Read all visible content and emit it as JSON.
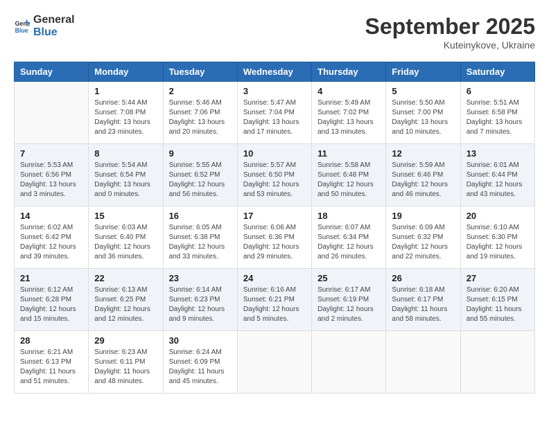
{
  "header": {
    "logo_general": "General",
    "logo_blue": "Blue",
    "month": "September 2025",
    "location": "Kuteinykove, Ukraine"
  },
  "days_of_week": [
    "Sunday",
    "Monday",
    "Tuesday",
    "Wednesday",
    "Thursday",
    "Friday",
    "Saturday"
  ],
  "weeks": [
    [
      {
        "day": "",
        "info": ""
      },
      {
        "day": "1",
        "info": "Sunrise: 5:44 AM\nSunset: 7:08 PM\nDaylight: 13 hours\nand 23 minutes."
      },
      {
        "day": "2",
        "info": "Sunrise: 5:46 AM\nSunset: 7:06 PM\nDaylight: 13 hours\nand 20 minutes."
      },
      {
        "day": "3",
        "info": "Sunrise: 5:47 AM\nSunset: 7:04 PM\nDaylight: 13 hours\nand 17 minutes."
      },
      {
        "day": "4",
        "info": "Sunrise: 5:49 AM\nSunset: 7:02 PM\nDaylight: 13 hours\nand 13 minutes."
      },
      {
        "day": "5",
        "info": "Sunrise: 5:50 AM\nSunset: 7:00 PM\nDaylight: 13 hours\nand 10 minutes."
      },
      {
        "day": "6",
        "info": "Sunrise: 5:51 AM\nSunset: 6:58 PM\nDaylight: 13 hours\nand 7 minutes."
      }
    ],
    [
      {
        "day": "7",
        "info": "Sunrise: 5:53 AM\nSunset: 6:56 PM\nDaylight: 13 hours\nand 3 minutes."
      },
      {
        "day": "8",
        "info": "Sunrise: 5:54 AM\nSunset: 6:54 PM\nDaylight: 13 hours\nand 0 minutes."
      },
      {
        "day": "9",
        "info": "Sunrise: 5:55 AM\nSunset: 6:52 PM\nDaylight: 12 hours\nand 56 minutes."
      },
      {
        "day": "10",
        "info": "Sunrise: 5:57 AM\nSunset: 6:50 PM\nDaylight: 12 hours\nand 53 minutes."
      },
      {
        "day": "11",
        "info": "Sunrise: 5:58 AM\nSunset: 6:48 PM\nDaylight: 12 hours\nand 50 minutes."
      },
      {
        "day": "12",
        "info": "Sunrise: 5:59 AM\nSunset: 6:46 PM\nDaylight: 12 hours\nand 46 minutes."
      },
      {
        "day": "13",
        "info": "Sunrise: 6:01 AM\nSunset: 6:44 PM\nDaylight: 12 hours\nand 43 minutes."
      }
    ],
    [
      {
        "day": "14",
        "info": "Sunrise: 6:02 AM\nSunset: 6:42 PM\nDaylight: 12 hours\nand 39 minutes."
      },
      {
        "day": "15",
        "info": "Sunrise: 6:03 AM\nSunset: 6:40 PM\nDaylight: 12 hours\nand 36 minutes."
      },
      {
        "day": "16",
        "info": "Sunrise: 6:05 AM\nSunset: 6:38 PM\nDaylight: 12 hours\nand 33 minutes."
      },
      {
        "day": "17",
        "info": "Sunrise: 6:06 AM\nSunset: 6:36 PM\nDaylight: 12 hours\nand 29 minutes."
      },
      {
        "day": "18",
        "info": "Sunrise: 6:07 AM\nSunset: 6:34 PM\nDaylight: 12 hours\nand 26 minutes."
      },
      {
        "day": "19",
        "info": "Sunrise: 6:09 AM\nSunset: 6:32 PM\nDaylight: 12 hours\nand 22 minutes."
      },
      {
        "day": "20",
        "info": "Sunrise: 6:10 AM\nSunset: 6:30 PM\nDaylight: 12 hours\nand 19 minutes."
      }
    ],
    [
      {
        "day": "21",
        "info": "Sunrise: 6:12 AM\nSunset: 6:28 PM\nDaylight: 12 hours\nand 15 minutes."
      },
      {
        "day": "22",
        "info": "Sunrise: 6:13 AM\nSunset: 6:25 PM\nDaylight: 12 hours\nand 12 minutes."
      },
      {
        "day": "23",
        "info": "Sunrise: 6:14 AM\nSunset: 6:23 PM\nDaylight: 12 hours\nand 9 minutes."
      },
      {
        "day": "24",
        "info": "Sunrise: 6:16 AM\nSunset: 6:21 PM\nDaylight: 12 hours\nand 5 minutes."
      },
      {
        "day": "25",
        "info": "Sunrise: 6:17 AM\nSunset: 6:19 PM\nDaylight: 12 hours\nand 2 minutes."
      },
      {
        "day": "26",
        "info": "Sunrise: 6:18 AM\nSunset: 6:17 PM\nDaylight: 11 hours\nand 58 minutes."
      },
      {
        "day": "27",
        "info": "Sunrise: 6:20 AM\nSunset: 6:15 PM\nDaylight: 11 hours\nand 55 minutes."
      }
    ],
    [
      {
        "day": "28",
        "info": "Sunrise: 6:21 AM\nSunset: 6:13 PM\nDaylight: 11 hours\nand 51 minutes."
      },
      {
        "day": "29",
        "info": "Sunrise: 6:23 AM\nSunset: 6:11 PM\nDaylight: 11 hours\nand 48 minutes."
      },
      {
        "day": "30",
        "info": "Sunrise: 6:24 AM\nSunset: 6:09 PM\nDaylight: 11 hours\nand 45 minutes."
      },
      {
        "day": "",
        "info": ""
      },
      {
        "day": "",
        "info": ""
      },
      {
        "day": "",
        "info": ""
      },
      {
        "day": "",
        "info": ""
      }
    ]
  ]
}
